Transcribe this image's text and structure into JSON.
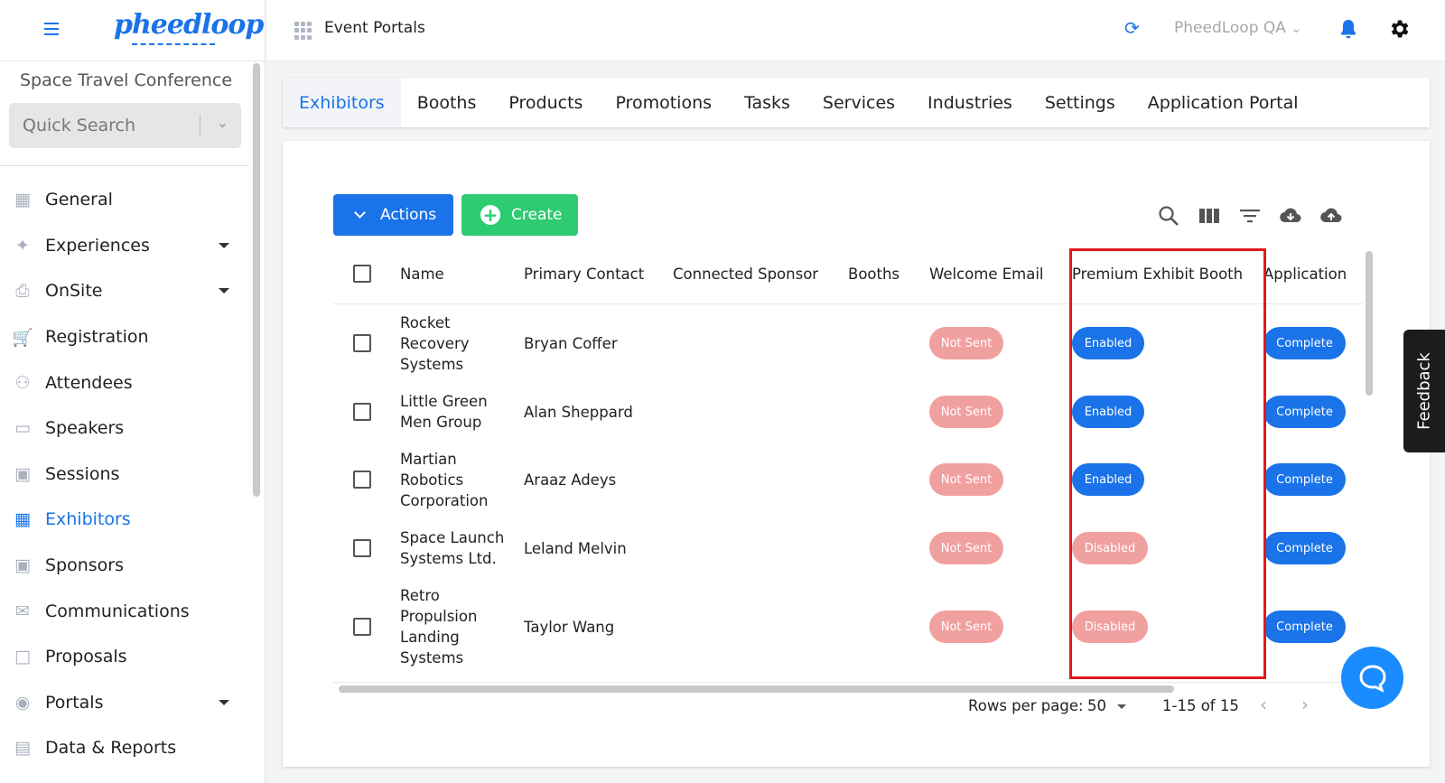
{
  "sidebar": {
    "logo": "pheedloop",
    "event_name": "Space Travel Conference",
    "search_placeholder": "Quick Search",
    "items": [
      {
        "label": "General",
        "icon": "grid-icon"
      },
      {
        "label": "Experiences",
        "icon": "person-icon",
        "expandable": true
      },
      {
        "label": "OnSite",
        "icon": "printer-icon",
        "expandable": true
      },
      {
        "label": "Registration",
        "icon": "cart-icon"
      },
      {
        "label": "Attendees",
        "icon": "people-icon"
      },
      {
        "label": "Speakers",
        "icon": "presenter-icon"
      },
      {
        "label": "Sessions",
        "icon": "laptop-icon"
      },
      {
        "label": "Exhibitors",
        "icon": "storefront-icon",
        "active": true
      },
      {
        "label": "Sponsors",
        "icon": "badge-icon"
      },
      {
        "label": "Communications",
        "icon": "envelope-icon"
      },
      {
        "label": "Proposals",
        "icon": "document-icon"
      },
      {
        "label": "Portals",
        "icon": "globe-icon",
        "expandable": true
      },
      {
        "label": "Data & Reports",
        "icon": "chart-icon"
      }
    ]
  },
  "topbar": {
    "title": "Event Portals",
    "org": "PheedLoop QA"
  },
  "tabs": [
    "Exhibitors",
    "Booths",
    "Products",
    "Promotions",
    "Tasks",
    "Services",
    "Industries",
    "Settings",
    "Application Portal"
  ],
  "toolbar": {
    "actions_label": "Actions",
    "create_label": "Create"
  },
  "table": {
    "columns": [
      "Name",
      "Primary Contact",
      "Connected Sponsor",
      "Booths",
      "Welcome Email",
      "Premium Exhibit Booth",
      "Application"
    ],
    "rows": [
      {
        "name_lines": [
          "Rocket",
          "Recovery",
          "Systems"
        ],
        "contact": "Bryan Coffer",
        "welcome": "Not Sent",
        "premium": "Enabled",
        "application": "Complete"
      },
      {
        "name_lines": [
          "Little Green",
          "Men Group"
        ],
        "contact": "Alan Sheppard",
        "welcome": "Not Sent",
        "premium": "Enabled",
        "application": "Complete"
      },
      {
        "name_lines": [
          "Martian",
          "Robotics",
          "Corporation"
        ],
        "contact": "Araaz Adeys",
        "welcome": "Not Sent",
        "premium": "Enabled",
        "application": "Complete"
      },
      {
        "name_lines": [
          "Space Launch",
          "Systems Ltd."
        ],
        "contact": "Leland Melvin",
        "welcome": "Not Sent",
        "premium": "Disabled",
        "application": "Complete"
      },
      {
        "name_lines": [
          "Retro",
          "Propulsion",
          "Landing",
          "Systems"
        ],
        "contact": "Taylor Wang",
        "welcome": "Not Sent",
        "premium": "Disabled",
        "application": "Complete"
      }
    ]
  },
  "pagination": {
    "rows_label": "Rows per page:",
    "rows_value": "50",
    "range": "1-15 of 15"
  },
  "feedback_label": "Feedback",
  "colors": {
    "accent": "#1a73e8",
    "create": "#2ecc71",
    "pill_red": "#f1a0a0",
    "highlight": "#e01a1a"
  }
}
